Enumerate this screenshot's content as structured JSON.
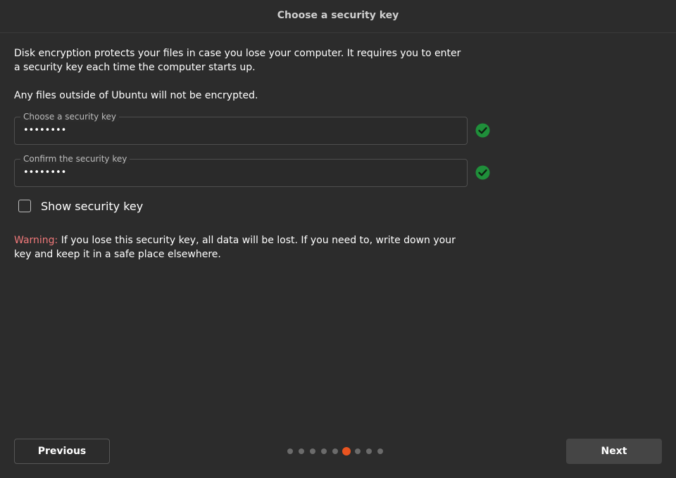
{
  "header": {
    "title": "Choose a security key"
  },
  "main": {
    "intro": "Disk encryption protects your files in case you lose your computer. It requires you to enter a security key each time the computer starts up.",
    "note": "Any files outside of Ubuntu will not be encrypted.",
    "key_field": {
      "label": "Choose a security key",
      "value": "••••••••",
      "status_icon": "check-circle-icon"
    },
    "confirm_field": {
      "label": "Confirm the security key",
      "value": "••••••••",
      "status_icon": "check-circle-icon"
    },
    "show_key": {
      "label": "Show security key",
      "checked": false
    },
    "warning": {
      "prefix": "Warning:",
      "text": " If you lose this security key, all data will be lost. If you need to, write down your key and keep it in a safe place elsewhere."
    }
  },
  "footer": {
    "previous_label": "Previous",
    "next_label": "Next",
    "progress": {
      "total_steps": 9,
      "current_step": 6
    }
  },
  "colors": {
    "background": "#2c2c2c",
    "accent": "#e95420",
    "success": "#26a269",
    "warning": "#f0797a"
  }
}
